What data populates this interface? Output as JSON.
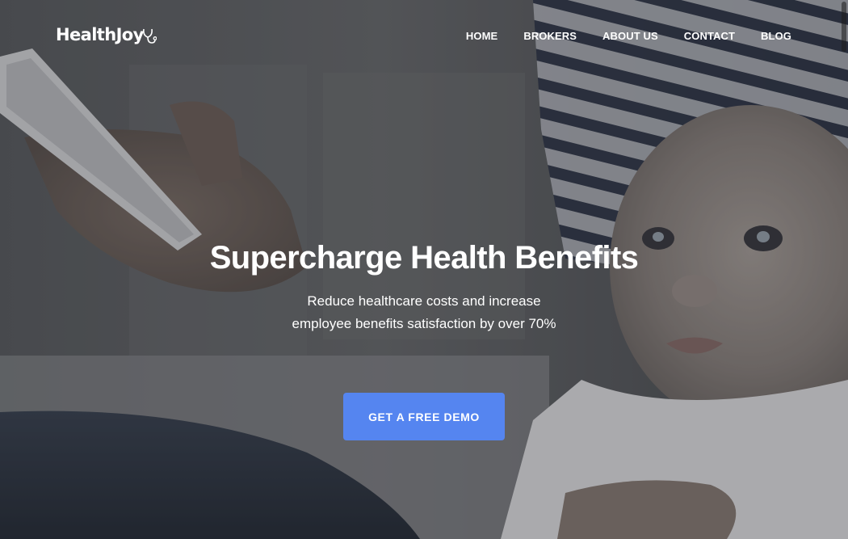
{
  "brand": {
    "logo_text": "HealthJoy",
    "logo_icon": "stethoscope-icon"
  },
  "nav": {
    "items": [
      {
        "label": "HOME"
      },
      {
        "label": "BROKERS"
      },
      {
        "label": "ABOUT US"
      },
      {
        "label": "CONTACT"
      },
      {
        "label": "BLOG"
      }
    ]
  },
  "hero": {
    "headline": "Supercharge Health Benefits",
    "subheadline_line1": "Reduce healthcare costs and increase",
    "subheadline_line2": "employee benefits satisfaction by over 70%",
    "cta_label": "GET A FREE DEMO"
  },
  "colors": {
    "cta_background": "#5585f0",
    "text": "#ffffff"
  }
}
